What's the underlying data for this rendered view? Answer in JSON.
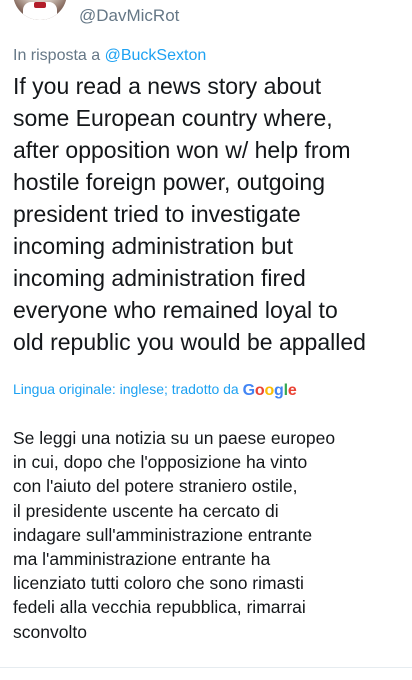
{
  "user": {
    "handle": "@DavMicRot"
  },
  "reply": {
    "prefix": "In risposta a ",
    "target": "@BuckSexton"
  },
  "tweet": {
    "lines": [
      "If you read a news story about",
      "some European country where,",
      "after opposition won w/ help from",
      "hostile foreign power, outgoing",
      "president tried to investigate",
      "incoming administration but",
      "incoming administration fired",
      "everyone who remained loyal to",
      "old republic you would be appalled"
    ]
  },
  "translation": {
    "label": "Lingua originale: inglese; tradotto da ",
    "provider": "Google",
    "lines": [
      "Se leggi una notizia su un paese europeo",
      "in cui, dopo che l'opposizione ha vinto",
      "con l'aiuto del potere straniero ostile,",
      "il presidente uscente ha cercato di",
      "indagare sull'amministrazione entrante",
      "ma l'amministrazione entrante ha",
      "licenziato tutti coloro che sono rimasti",
      "fedeli alla vecchia repubblica, rimarrai",
      "sconvolto"
    ]
  },
  "colors": {
    "link": "#1da1f2",
    "secondary_text": "#657786",
    "primary_text": "#14171a"
  }
}
